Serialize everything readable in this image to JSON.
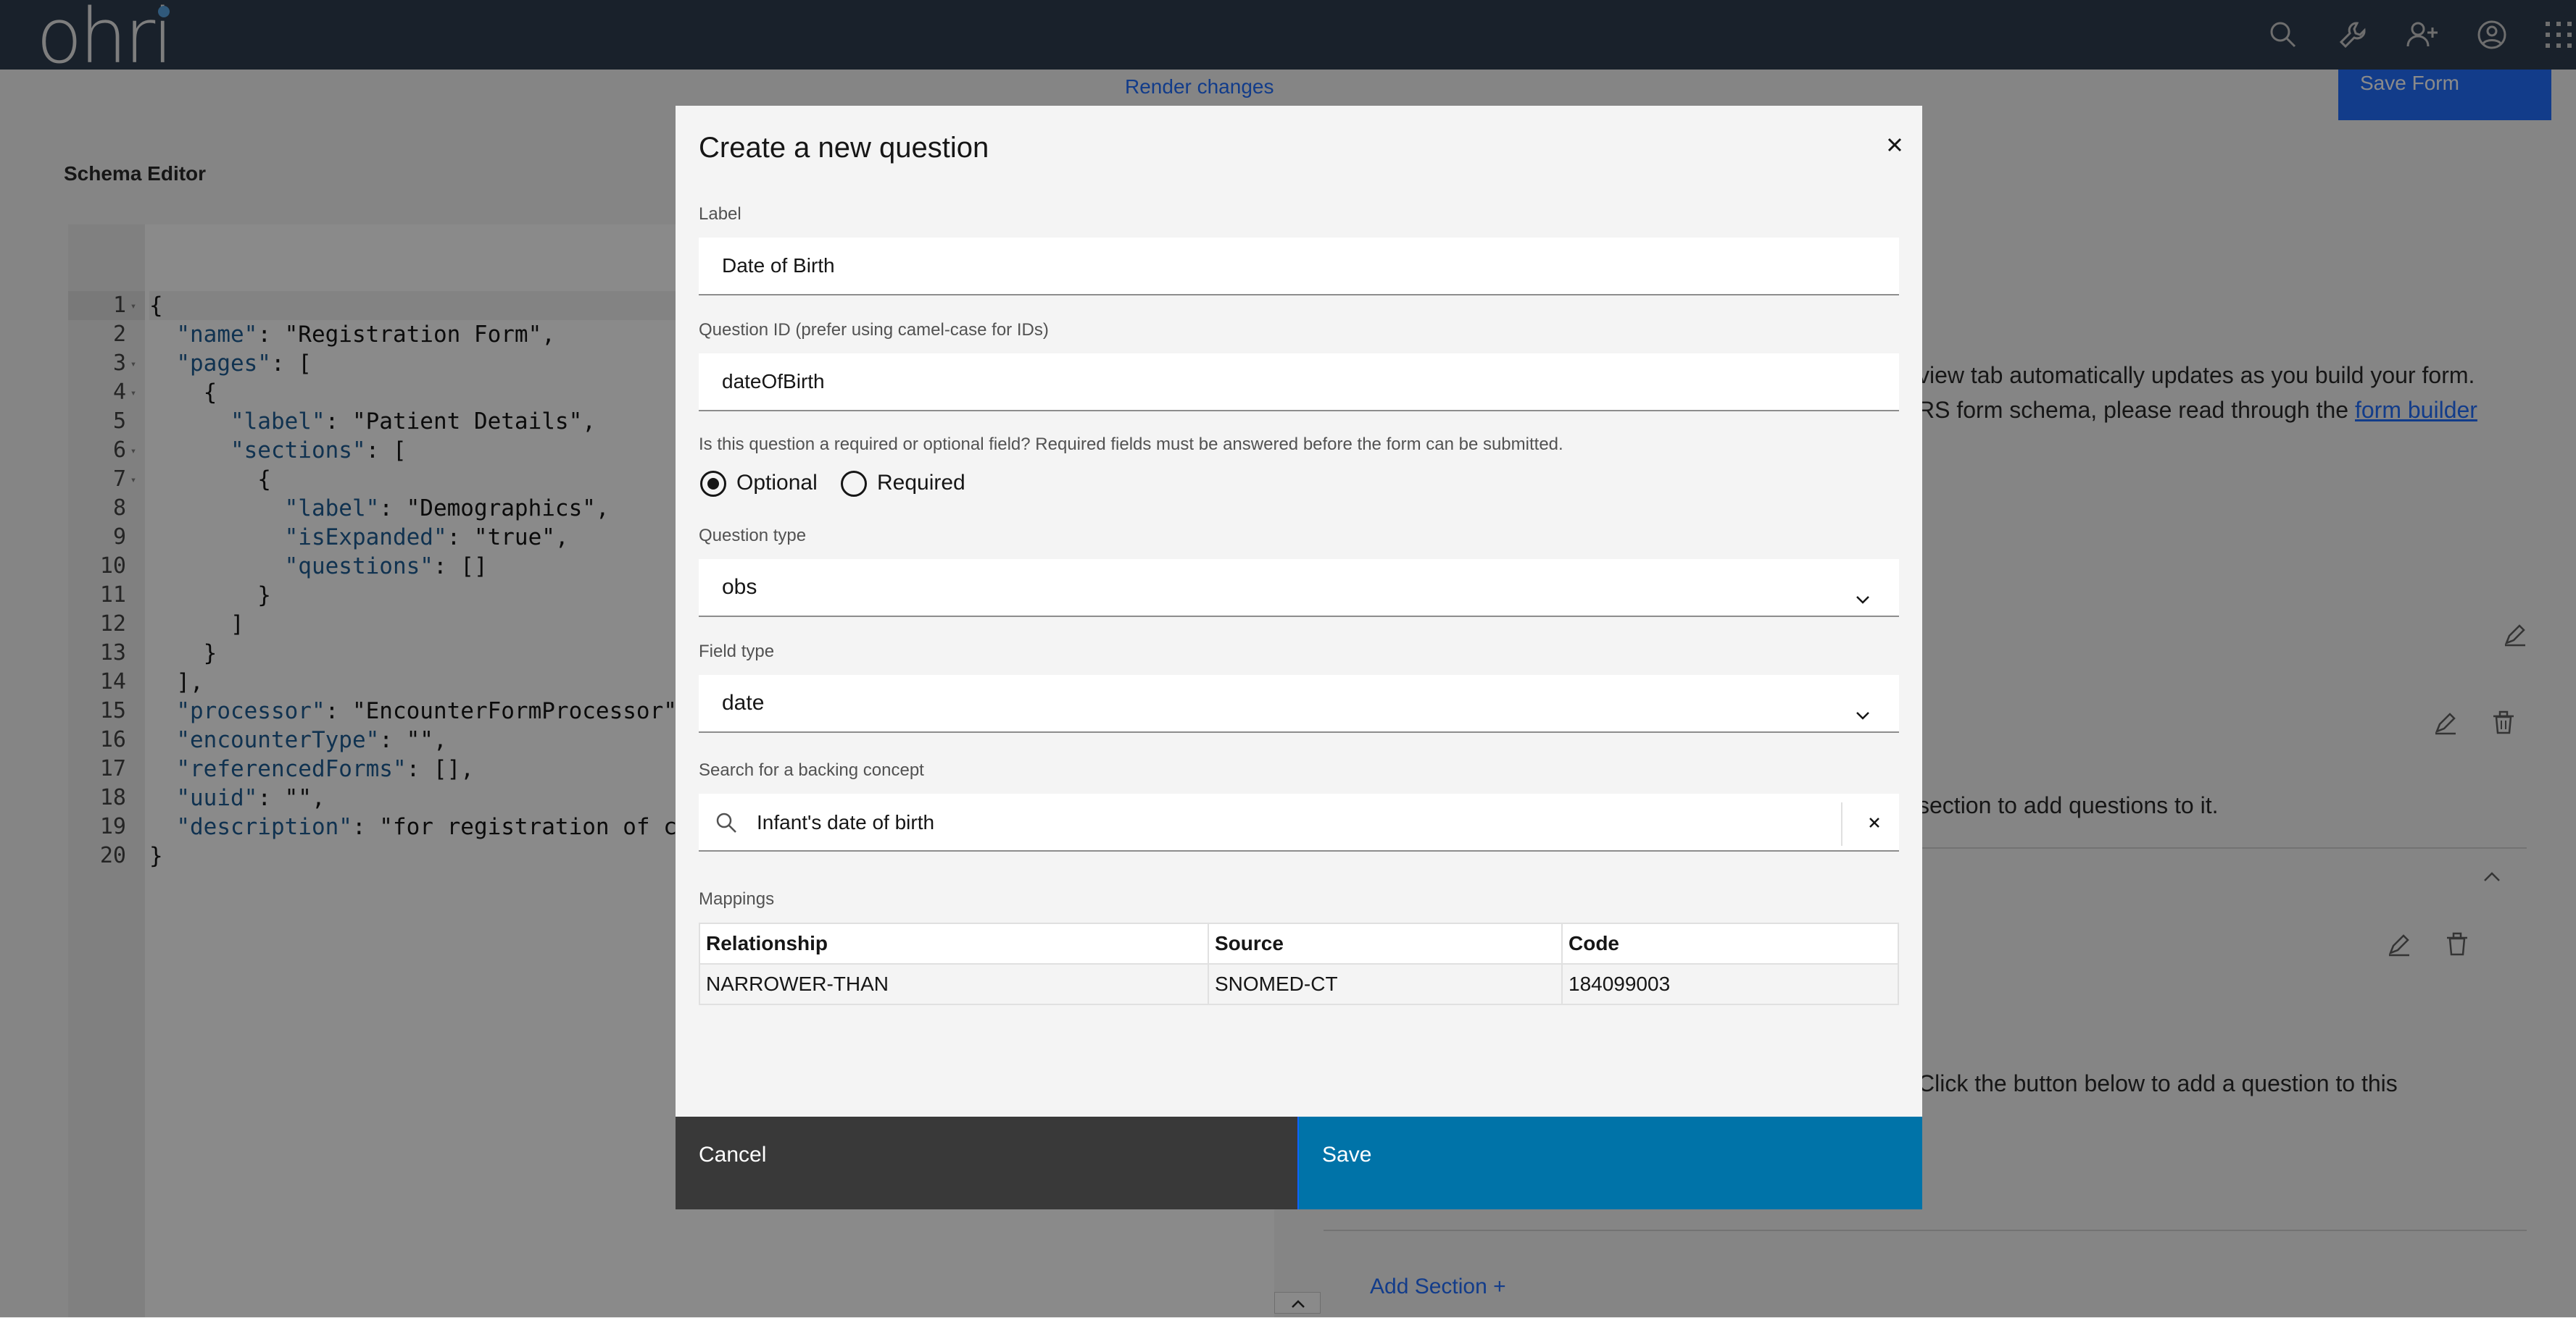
{
  "app": {
    "logo_text": "ohri"
  },
  "topbar": {
    "icons": [
      "search-icon",
      "tools-icon",
      "add-user-icon",
      "user-avatar-icon",
      "app-switcher-icon"
    ]
  },
  "page": {
    "render_changes": "Render changes",
    "save_form": "Save Form",
    "schema_editor_title": "Schema Editor",
    "code_lines": [
      {
        "num": "1",
        "fold": true,
        "text": "{"
      },
      {
        "num": "2",
        "fold": false,
        "text": "  \"name\": \"Registration Form\","
      },
      {
        "num": "3",
        "fold": true,
        "text": "  \"pages\": ["
      },
      {
        "num": "4",
        "fold": true,
        "text": "    {"
      },
      {
        "num": "5",
        "fold": false,
        "text": "      \"label\": \"Patient Details\","
      },
      {
        "num": "6",
        "fold": true,
        "text": "      \"sections\": ["
      },
      {
        "num": "7",
        "fold": true,
        "text": "        {"
      },
      {
        "num": "8",
        "fold": false,
        "text": "          \"label\": \"Demographics\","
      },
      {
        "num": "9",
        "fold": false,
        "text": "          \"isExpanded\": \"true\","
      },
      {
        "num": "10",
        "fold": false,
        "text": "          \"questions\": []"
      },
      {
        "num": "11",
        "fold": false,
        "text": "        }"
      },
      {
        "num": "12",
        "fold": false,
        "text": "      ]"
      },
      {
        "num": "13",
        "fold": false,
        "text": "    }"
      },
      {
        "num": "14",
        "fold": false,
        "text": "  ],"
      },
      {
        "num": "15",
        "fold": false,
        "text": "  \"processor\": \"EncounterFormProcessor\","
      },
      {
        "num": "16",
        "fold": false,
        "text": "  \"encounterType\": \"\","
      },
      {
        "num": "17",
        "fold": false,
        "text": "  \"referencedForms\": [],"
      },
      {
        "num": "18",
        "fold": false,
        "text": "  \"uuid\": \"\","
      },
      {
        "num": "19",
        "fold": false,
        "text": "  \"description\": \"for registration of cl"
      },
      {
        "num": "20",
        "fold": false,
        "text": "}"
      }
    ],
    "right_text_1": "view tab automatically updates as you build your form.",
    "right_text_2": "RS form schema, please read through the ",
    "right_link": "form builder",
    "right_text_3": "section to add questions to it.",
    "right_text_4": "Click the button below to add a question to this",
    "add_section": "Add Section  +"
  },
  "modal": {
    "title": "Create a new question",
    "label_label": "Label",
    "label_value": "Date of Birth",
    "qid_label": "Question ID (prefer using camel-case for IDs)",
    "qid_value": "dateOfBirth",
    "required_hint": "Is this question a required or optional field? Required fields must be answered before the form can be submitted.",
    "optional_label": "Optional",
    "required_label": "Required",
    "selected_requirement": "Optional",
    "question_type_label": "Question type",
    "question_type_value": "obs",
    "field_type_label": "Field type",
    "field_type_value": "date",
    "concept_label": "Search for a backing concept",
    "concept_value": "Infant's date of birth",
    "mappings_label": "Mappings",
    "mappings": {
      "headers": [
        "Relationship",
        "Source",
        "Code"
      ],
      "rows": [
        [
          "NARROWER-THAN",
          "SNOMED-CT",
          "184099003"
        ]
      ]
    },
    "cancel": "Cancel",
    "save": "Save"
  },
  "colors": {
    "topbar": "#1c2c40",
    "primary_button": "#0073a8",
    "secondary_button": "#393939",
    "link": "#0f62fe"
  }
}
